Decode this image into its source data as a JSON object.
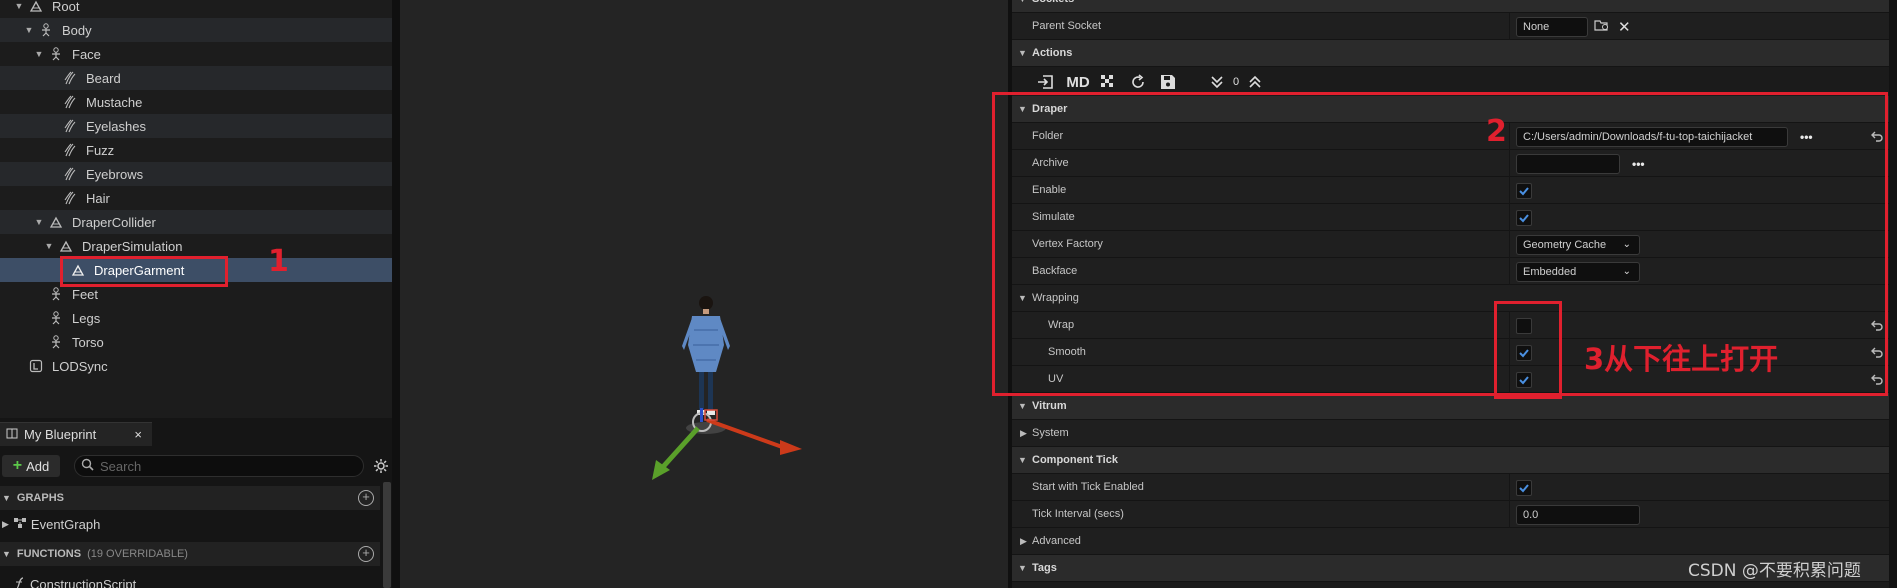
{
  "tree": {
    "items": [
      {
        "label": "Root"
      },
      {
        "label": "Body"
      },
      {
        "label": "Face"
      },
      {
        "label": "Beard"
      },
      {
        "label": "Mustache"
      },
      {
        "label": "Eyelashes"
      },
      {
        "label": "Fuzz"
      },
      {
        "label": "Eyebrows"
      },
      {
        "label": "Hair"
      },
      {
        "label": "DraperCollider"
      },
      {
        "label": "DraperSimulation"
      },
      {
        "label": "DraperGarment"
      },
      {
        "label": "Feet"
      },
      {
        "label": "Legs"
      },
      {
        "label": "Torso"
      },
      {
        "label": "LODSync"
      }
    ]
  },
  "blueprint": {
    "tab_label": "My Blueprint",
    "close": "×",
    "add_label": "Add",
    "search_placeholder": "Search",
    "graphs_label": "GRAPHS",
    "event_graph": "EventGraph",
    "functions_label": "FUNCTIONS",
    "functions_count": "(19 OVERRIDABLE)",
    "construction_script": "ConstructionScript"
  },
  "details": {
    "sockets": {
      "category": "Sockets",
      "parent_socket_label": "Parent Socket",
      "parent_socket_value": "None"
    },
    "actions": {
      "category": "Actions",
      "md_label": "MD",
      "counter": "0"
    },
    "draper": {
      "category": "Draper",
      "folder_label": "Folder",
      "folder_value": "C:/Users/admin/Downloads/f-tu-top-taichijacket",
      "archive_label": "Archive",
      "archive_value": "",
      "enable_label": "Enable",
      "enable_checked": true,
      "simulate_label": "Simulate",
      "simulate_checked": true,
      "vertex_factory_label": "Vertex Factory",
      "vertex_factory_value": "Geometry Cache",
      "backface_label": "Backface",
      "backface_value": "Embedded",
      "wrapping_label": "Wrapping",
      "wrap_label": "Wrap",
      "wrap_checked": false,
      "smooth_label": "Smooth",
      "smooth_checked": true,
      "uv_label": "UV",
      "uv_checked": true
    },
    "vitrum": {
      "category": "Vitrum",
      "system_label": "System"
    },
    "component_tick": {
      "category": "Component Tick",
      "start_label": "Start with Tick Enabled",
      "start_checked": true,
      "interval_label": "Tick Interval (secs)",
      "interval_value": "0.0",
      "advanced_label": "Advanced"
    },
    "tags": {
      "category": "Tags"
    }
  },
  "annotations": {
    "one": "1",
    "two": "2",
    "three": "3从下往上打开"
  },
  "watermark": "CSDN @不要积累问题",
  "colors": {
    "accent_red": "#e0202e",
    "selection": "#3d4e66",
    "checkbox_check": "#4a90e2"
  }
}
